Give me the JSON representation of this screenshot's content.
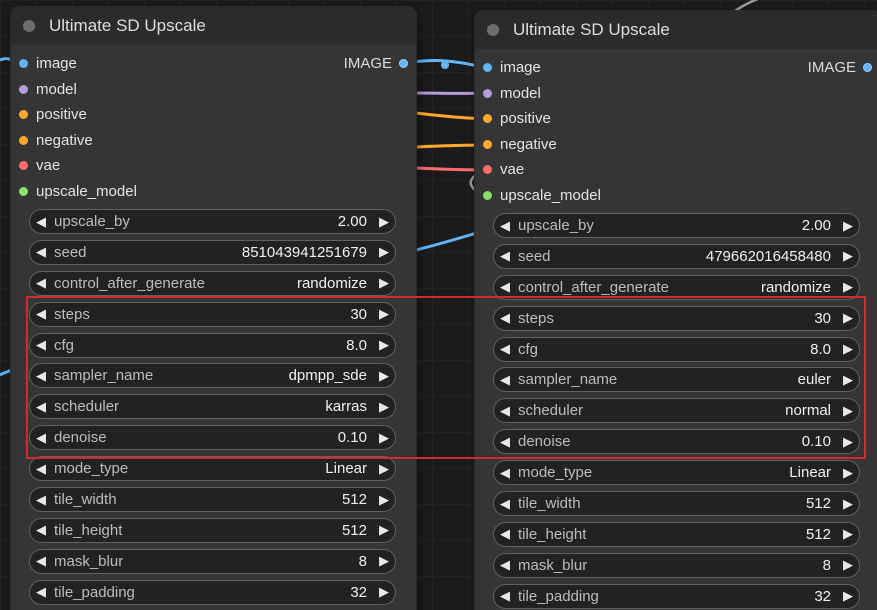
{
  "colors": {
    "image": "#64b5f6",
    "model": "#b39ddb",
    "positive": "#ffa931",
    "negative": "#ffa931",
    "vae": "#ff6e6e",
    "upscale_model": "#8be06b",
    "highlight": "#d42a2a"
  },
  "nodes": [
    {
      "title": "Ultimate SD Upscale",
      "output_label": "IMAGE",
      "inputs": [
        {
          "label": "image",
          "color": "#64b5f6"
        },
        {
          "label": "model",
          "color": "#b39ddb"
        },
        {
          "label": "positive",
          "color": "#ffa931"
        },
        {
          "label": "negative",
          "color": "#ffa931"
        },
        {
          "label": "vae",
          "color": "#ff6e6e"
        },
        {
          "label": "upscale_model",
          "color": "#8be06b"
        }
      ],
      "widgets": [
        {
          "name": "upscale_by",
          "value": "2.00"
        },
        {
          "name": "seed",
          "value": "851043941251679"
        },
        {
          "name": "control_after_generate",
          "value": "randomize"
        },
        {
          "name": "steps",
          "value": "30"
        },
        {
          "name": "cfg",
          "value": "8.0"
        },
        {
          "name": "sampler_name",
          "value": "dpmpp_sde"
        },
        {
          "name": "scheduler",
          "value": "karras"
        },
        {
          "name": "denoise",
          "value": "0.10"
        },
        {
          "name": "mode_type",
          "value": "Linear"
        },
        {
          "name": "tile_width",
          "value": "512"
        },
        {
          "name": "tile_height",
          "value": "512"
        },
        {
          "name": "mask_blur",
          "value": "8"
        },
        {
          "name": "tile_padding",
          "value": "32"
        }
      ]
    },
    {
      "title": "Ultimate SD Upscale",
      "output_label": "IMAGE",
      "inputs": [
        {
          "label": "image",
          "color": "#64b5f6"
        },
        {
          "label": "model",
          "color": "#b39ddb"
        },
        {
          "label": "positive",
          "color": "#ffa931"
        },
        {
          "label": "negative",
          "color": "#ffa931"
        },
        {
          "label": "vae",
          "color": "#ff6e6e"
        },
        {
          "label": "upscale_model",
          "color": "#8be06b"
        }
      ],
      "widgets": [
        {
          "name": "upscale_by",
          "value": "2.00"
        },
        {
          "name": "seed",
          "value": "479662016458480"
        },
        {
          "name": "control_after_generate",
          "value": "randomize"
        },
        {
          "name": "steps",
          "value": "30"
        },
        {
          "name": "cfg",
          "value": "8.0"
        },
        {
          "name": "sampler_name",
          "value": "euler"
        },
        {
          "name": "scheduler",
          "value": "normal"
        },
        {
          "name": "denoise",
          "value": "0.10"
        },
        {
          "name": "mode_type",
          "value": "Linear"
        },
        {
          "name": "tile_width",
          "value": "512"
        },
        {
          "name": "tile_height",
          "value": "512"
        },
        {
          "name": "mask_blur",
          "value": "8"
        },
        {
          "name": "tile_padding",
          "value": "32"
        }
      ]
    }
  ]
}
